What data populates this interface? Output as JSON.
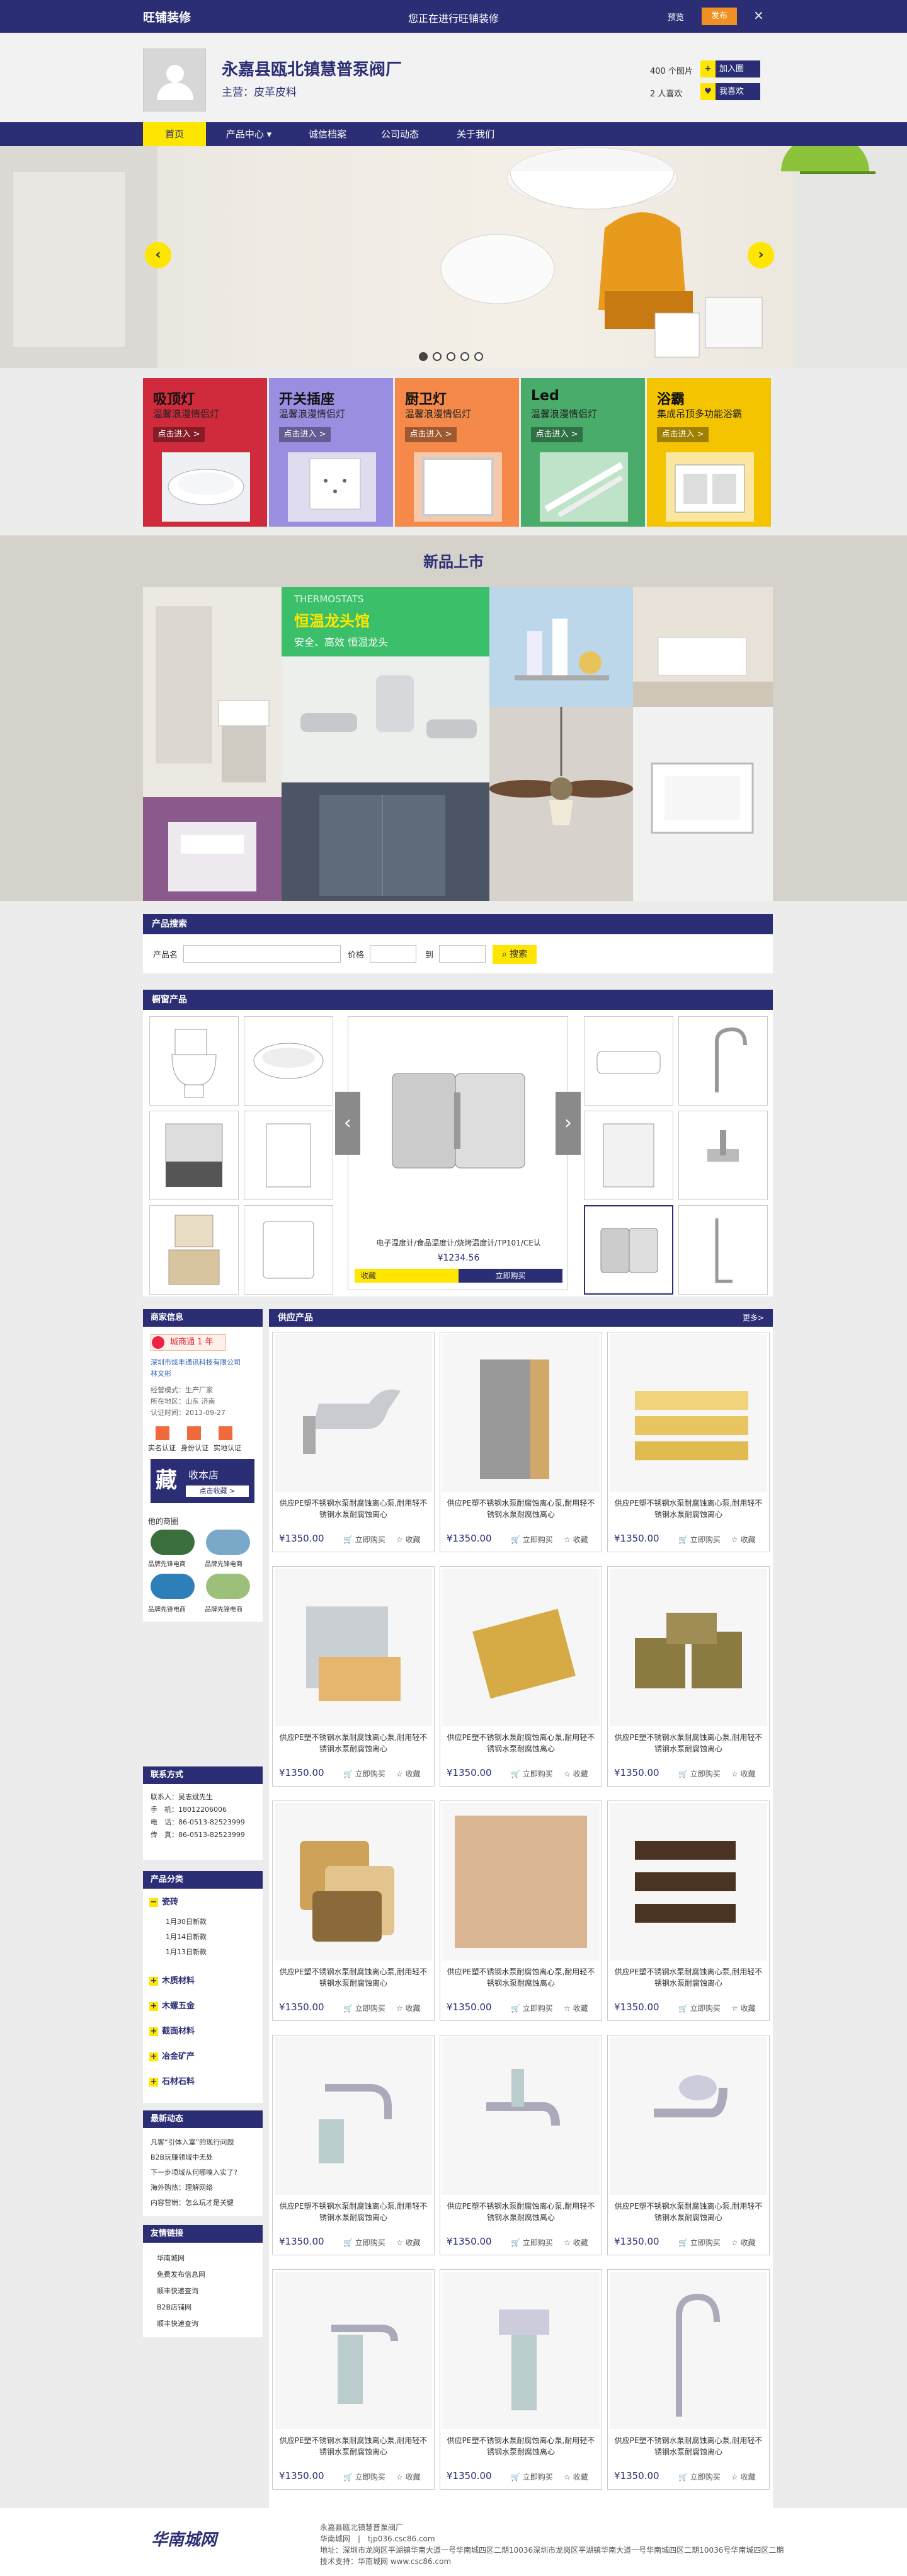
{
  "topbar": {
    "brand": "旺铺装修",
    "message": "您正在进行旺铺装修",
    "preview": "预览",
    "publish": "发布",
    "close": "×"
  },
  "header": {
    "shop_name": "永嘉县瓯北镇慧普泵阀厂",
    "main_business": "主营：皮革皮料",
    "stat_visits": "400 个图片",
    "stat_likes": "2 人喜欢",
    "btn_join": "加入圈",
    "btn_like": "我喜欢"
  },
  "nav": {
    "items": [
      "首页",
      "产品中心 ▾",
      "诚信档案",
      "公司动态",
      "关于我们"
    ]
  },
  "banner": {
    "prev": "‹",
    "next": "›"
  },
  "categories": [
    {
      "title": "吸顶灯",
      "sub": "温馨浪漫情侣灯",
      "btn": "点击进入 >",
      "color": "#d02b3c"
    },
    {
      "title": "开关插座",
      "sub": "温馨浪漫情侣灯",
      "btn": "点击进入 >",
      "color": "#9a8ee0"
    },
    {
      "title": "厨卫灯",
      "sub": "温馨浪漫情侣灯",
      "btn": "点击进入 >",
      "color": "#f4894a"
    },
    {
      "title": "Led",
      "sub": "温馨浪漫情侣灯",
      "btn": "点击进入 >",
      "color": "#4aac6a"
    },
    {
      "title": "浴霸",
      "sub": "集成吊顶多功能浴霸",
      "btn": "点击进入 >",
      "color": "#f5c400"
    }
  ],
  "new_section": {
    "title": "新品上市",
    "thermo_label": "THERMOSTATS",
    "thermo_title": "恒温龙头馆",
    "thermo_sub": "安全、高效  恒温龙头"
  },
  "search": {
    "header": "产品搜索",
    "name_label": "产品名",
    "price_label": "价格",
    "to_label": "到",
    "btn": "搜索"
  },
  "featured": {
    "header": "橱窗产品",
    "caption": "电子温度计/食品温度计/烧烤温度计/TP101/CE认",
    "price": "¥1234.56",
    "btn_fav": "收藏",
    "btn_buy": "立即购买",
    "left": "‹",
    "right": "›"
  },
  "merchant": {
    "header": "商家信息",
    "badge": "城商通 1 年",
    "company": "深圳市炫丰通讯科技有限公司",
    "contact": "林文彬",
    "type": "经营模式：生产厂家",
    "area": "所在地区：山东 济南",
    "reg": "认证时间：2013-09-27",
    "cert1": "实名认证",
    "cert2": "身份认证",
    "cert3": "实地认证",
    "fav_big": "藏",
    "fav_text": "收本店",
    "fav_btn": "点击收藏 >"
  },
  "others": {
    "header": "他的商圈",
    "items": [
      "品牌先锋电商",
      "品牌先锋电商",
      "品牌先锋电商",
      "品牌先锋电商"
    ]
  },
  "contact": {
    "header": "联系方式",
    "person": "联系人：吴志斌先生",
    "mobile": "手　机：18012206006",
    "phone": "电　话：86-0513-82523999",
    "fax": "传　真：86-0513-82523999"
  },
  "classify": {
    "header": "产品分类",
    "groups": [
      "瓷砖",
      "木质材料",
      "木螺五金",
      "截面材料",
      "冶金矿产",
      "石材石料"
    ],
    "subs": [
      "1月30日新款",
      "1月14日新款",
      "1月13日新款"
    ]
  },
  "news": {
    "header": "最新动态",
    "items": [
      "凡客“引体入室”的现行问题",
      "B2B玩赚领域中无处",
      "下一步项域从何哪嗅入实了?",
      "海外购热：理解网络",
      "内容营销：怎么玩才是关键"
    ]
  },
  "links": {
    "header": "友情链接",
    "items": [
      "华南城网",
      "免费发布信息网",
      "顺丰快递查询",
      "B2B店铺网",
      "顺丰快递查询"
    ]
  },
  "products": {
    "header": "供应产品",
    "more": "更多>",
    "title": "供应PE塑不锈钢水泵耐腐蚀离心泵,耐用轻不锈钢水泵耐腐蚀离心",
    "price": "¥1350.00",
    "buy": "立即购买",
    "fav": "收藏"
  },
  "footer": {
    "line1": "永嘉县瓯北镇慧普泵阀厂",
    "line2": "华南城网　|　tjp036.csc86.com",
    "line3": "地址：深圳市龙岗区平湖镇华南大道一号华南城四区二期10036深圳市龙岗区平湖镇华南大道一号华南城四区二期10036号华南城四区二期",
    "line4": "技术支持：华南城网  www.csc86.com",
    "logo": "华南城网"
  },
  "colors": {
    "navy": "#2b2e74",
    "yellow": "#ffe600",
    "orange": "#f08f22"
  }
}
